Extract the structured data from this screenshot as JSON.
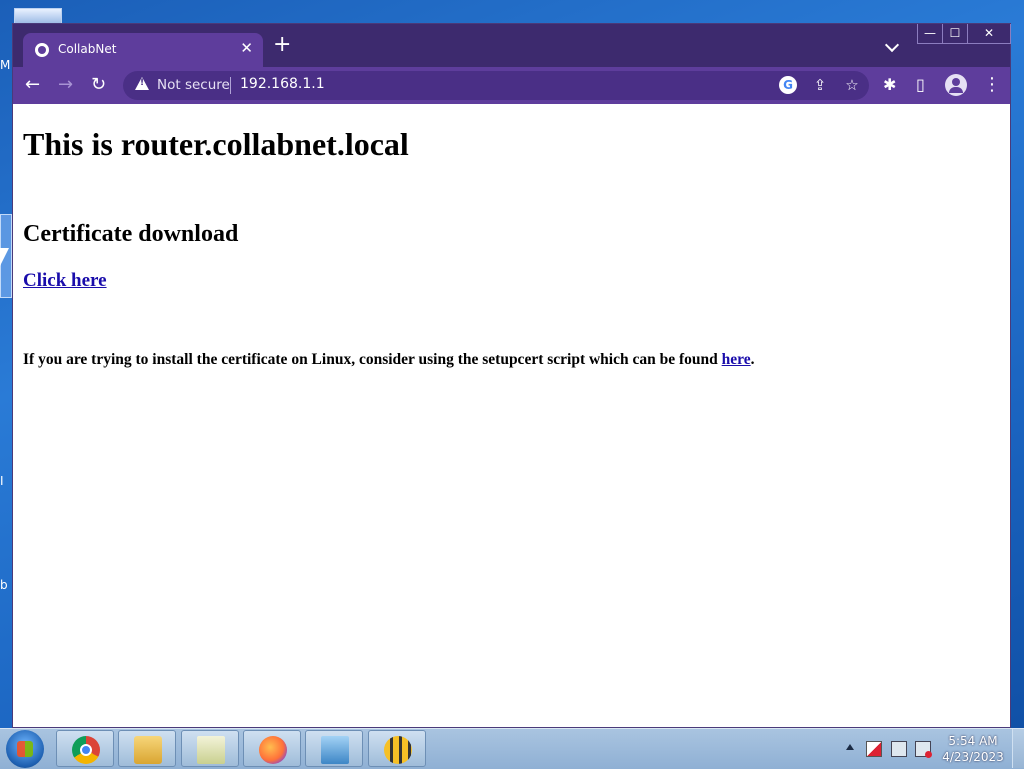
{
  "desktop": {
    "fragments": [
      "M",
      "I",
      "b"
    ]
  },
  "browser": {
    "tab": {
      "title": "CollabNet"
    },
    "window_controls": {
      "minimize": "—",
      "maximize": "☐",
      "close": "✕"
    },
    "omnibox": {
      "security_label": "Not secure",
      "url": "192.168.1.1"
    }
  },
  "page": {
    "heading": "This is router.collabnet.local",
    "subheading": "Certificate download",
    "download_link": "Click here",
    "note_text": "If you are trying to install the certificate on Linux, consider using the setupcert script which can be found ",
    "note_link": "here",
    "note_end": "."
  },
  "taskbar": {
    "apps": [
      "chrome",
      "file-explorer",
      "notepad",
      "firefox",
      "control-panel",
      "bee-app"
    ],
    "clock": {
      "time": "5:54 AM",
      "date": "4/23/2023"
    }
  }
}
